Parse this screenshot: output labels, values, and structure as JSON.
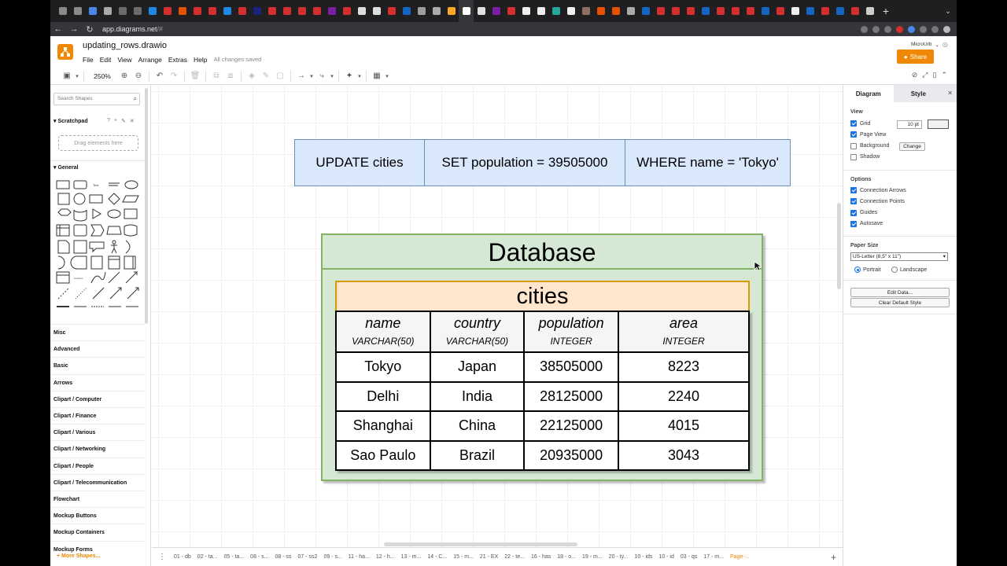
{
  "browser": {
    "url": "app.diagrams.net",
    "url_suffix": "/#",
    "tab_colors": [
      "#8a8a8a",
      "#8a8a8a",
      "#4a86e8",
      "#aaaaaa",
      "#6b6b6b",
      "#6b6b6b",
      "#1e88e5",
      "#d32f2f",
      "#e65100",
      "#d32f2f",
      "#d32f2f",
      "#1e88e5",
      "#d32f2f",
      "#1a237e",
      "#d32f2f",
      "#d32f2f",
      "#d32f2f",
      "#d32f2f",
      "#7b1fa2",
      "#d32f2f",
      "#dddddd",
      "#dddddd",
      "#d32f2f",
      "#1565c0",
      "#9e9e9e",
      "#aaaaaa",
      "#f9a825",
      "#ffffff",
      "#e0e0e0",
      "#7b1fa2",
      "#d32f2f",
      "#eeeeee",
      "#eeeeee",
      "#26a69a",
      "#eeeeee",
      "#8d6e63",
      "#e65100",
      "#e65100",
      "#aaaaaa",
      "#1565c0",
      "#d32f2f",
      "#d32f2f",
      "#d32f2f",
      "#1565c0",
      "#d32f2f",
      "#d32f2f",
      "#d32f2f",
      "#1565c0",
      "#d32f2f",
      "#eeeeee",
      "#1565c0",
      "#d32f2f",
      "#1565c0",
      "#d32f2f",
      "#cccccc"
    ]
  },
  "app": {
    "filename": "updating_rows.drawio",
    "menu": [
      "File",
      "Edit",
      "View",
      "Arrange",
      "Extras",
      "Help"
    ],
    "save_status": "All changes saved",
    "account": "MicroUrb",
    "share_label": "Share",
    "accent": "#f08705"
  },
  "toolbar": {
    "zoom": "250%"
  },
  "sidebar": {
    "search_placeholder": "Search Shapes",
    "scratchpad_title": "Scratchpad",
    "drop_hint": "Drag elements here",
    "general_title": "General",
    "categories": [
      "Misc",
      "Advanced",
      "Basic",
      "Arrows",
      "Clipart / Computer",
      "Clipart / Finance",
      "Clipart / Various",
      "Clipart / Networking",
      "Clipart / People",
      "Clipart / Telecommunication",
      "Flowchart",
      "Mockup Buttons",
      "Mockup Containers",
      "Mockup Forms"
    ],
    "more_shapes": "+ More Shapes..."
  },
  "diagram": {
    "sql": {
      "update": "UPDATE cities",
      "set": "SET population = 39505000",
      "where": "WHERE name = 'Tokyo'"
    },
    "database_title": "Database",
    "table_title": "cities",
    "columns": [
      {
        "name": "name",
        "type": "VARCHAR(50)"
      },
      {
        "name": "country",
        "type": "VARCHAR(50)"
      },
      {
        "name": "population",
        "type": "INTEGER"
      },
      {
        "name": "area",
        "type": "INTEGER"
      }
    ],
    "rows": [
      [
        "Tokyo",
        "Japan",
        "38505000",
        "8223"
      ],
      [
        "Delhi",
        "India",
        "28125000",
        "2240"
      ],
      [
        "Shanghai",
        "China",
        "22125000",
        "4015"
      ],
      [
        "Sao Paulo",
        "Brazil",
        "20935000",
        "3043"
      ]
    ]
  },
  "pages": [
    "01 - db",
    "02 - ta...",
    "05 - ta...",
    "08 - s...",
    "08 - ss",
    "07 - ss2",
    "09 - s...",
    "11 - ha...",
    "12 - h...",
    "13 - m...",
    "14 - C...",
    "15 - m...",
    "21 - EX",
    "22 - te...",
    "16 - has",
    "18 - o...",
    "19 - m...",
    "20 - ty...",
    "10 - ids",
    "10 - id",
    "03 - qs",
    "17 - m...",
    "Page-..."
  ],
  "format_panel": {
    "tabs": [
      "Diagram",
      "Style"
    ],
    "view_title": "View",
    "view_options": [
      {
        "label": "Grid",
        "checked": true
      },
      {
        "label": "Page View",
        "checked": true
      },
      {
        "label": "Background",
        "checked": false
      },
      {
        "label": "Shadow",
        "checked": false
      }
    ],
    "grid_size": "10 pt",
    "change_label": "Change",
    "options_title": "Options",
    "options": [
      {
        "label": "Connection Arrows",
        "checked": true
      },
      {
        "label": "Connection Points",
        "checked": true
      },
      {
        "label": "Guides",
        "checked": true
      },
      {
        "label": "Autosave",
        "checked": true
      }
    ],
    "paper_title": "Paper Size",
    "paper_size": "US-Letter (8,5\" x 11\")",
    "portrait": "Portrait",
    "landscape": "Landscape",
    "edit_data": "Edit Data...",
    "clear_style": "Clear Default Style"
  }
}
